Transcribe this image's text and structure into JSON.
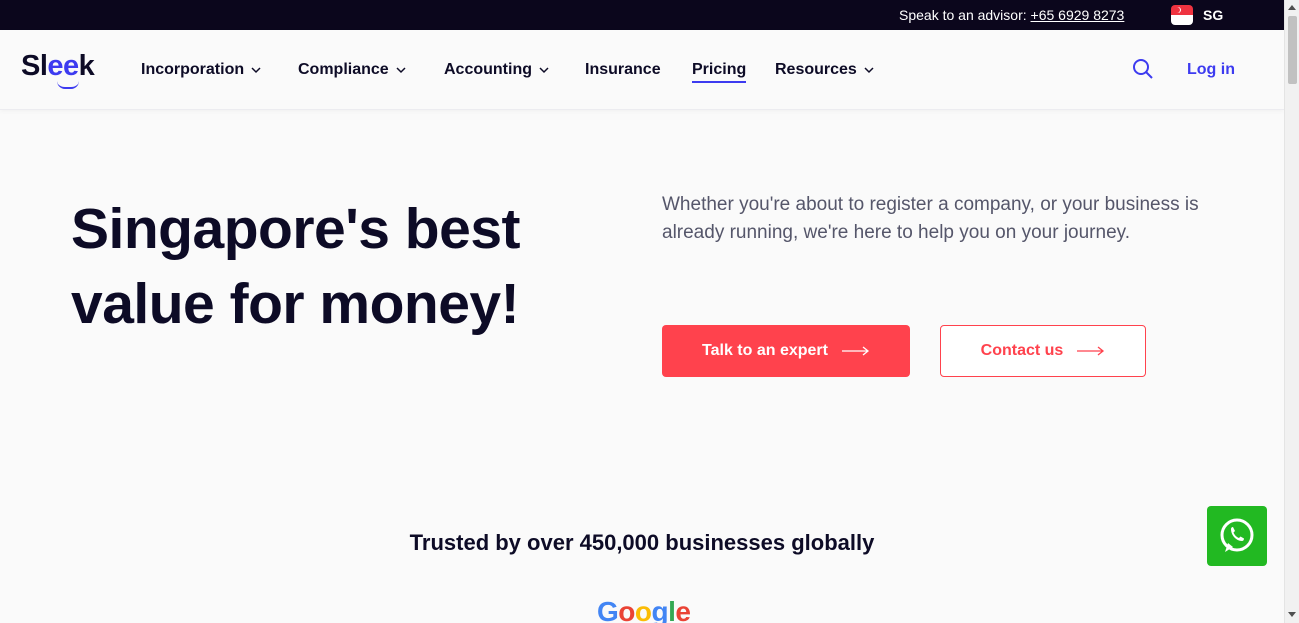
{
  "topbar": {
    "advisor_label": "Speak to an advisor: ",
    "advisor_phone": "+65 6929 8273",
    "region": "SG"
  },
  "nav": {
    "logo_prefix": "Sl",
    "logo_ee": "ee",
    "logo_suffix": "k",
    "items": [
      {
        "label": "Incorporation",
        "dropdown": true
      },
      {
        "label": "Compliance",
        "dropdown": true
      },
      {
        "label": "Accounting",
        "dropdown": true
      },
      {
        "label": "Insurance",
        "dropdown": false
      },
      {
        "label": "Pricing",
        "dropdown": false,
        "active": true
      },
      {
        "label": "Resources",
        "dropdown": true
      }
    ],
    "search_icon": "search-icon",
    "login_label": "Log in"
  },
  "hero": {
    "headline_line1": "Singapore's best",
    "headline_line2": "value for money!",
    "subtext": "Whether you're about to register a company, or your business is already running, we're here to help you on your journey.",
    "cta_primary": "Talk to an expert",
    "cta_secondary": "Contact us"
  },
  "trust": {
    "heading": "Trusted by over 450,000 businesses globally",
    "logo_text": "Google"
  },
  "colors": {
    "brand_blue": "#3d3bf0",
    "accent_red": "#ff424d",
    "dark": "#0d0b26",
    "topbar_bg": "#0b061c",
    "whatsapp_green": "#22b922"
  },
  "icons": {
    "whatsapp": "whatsapp-icon",
    "arrow": "arrow-right-icon",
    "chevron": "chevron-down-icon",
    "flag": "singapore-flag-icon"
  }
}
